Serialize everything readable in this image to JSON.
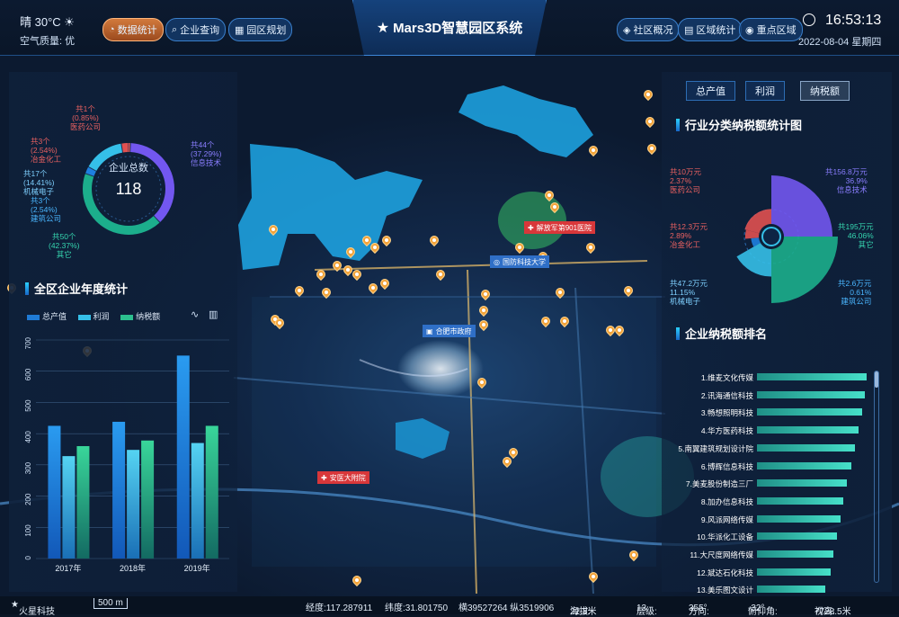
{
  "header": {
    "weather": "晴 30°C",
    "air_quality_label": "空气质量:",
    "air_quality_value": "优",
    "title": "Mars3D智慧园区系统",
    "time": "16:53:13",
    "date": "2022-08-04 星期四",
    "nav_left": [
      "数据统计",
      "企业查询",
      "园区规划"
    ],
    "nav_right": [
      "社区概况",
      "区域统计",
      "重点区域"
    ]
  },
  "left_panel": {
    "donut": {
      "center_label": "企业总数",
      "center_value": "118",
      "labels": [
        {
          "count": "共1个",
          "pct": "(0.85%)",
          "name": "医药公司"
        },
        {
          "count": "共3个",
          "pct": "(2.54%)",
          "name": "冶金化工"
        },
        {
          "count": "共17个",
          "pct": "(14.41%)",
          "name": "机械电子"
        },
        {
          "count": "共3个",
          "pct": "(2.54%)",
          "name": "建筑公司"
        },
        {
          "count": "共50个",
          "pct": "(42.37%)",
          "name": "其它"
        },
        {
          "count": "共44个",
          "pct": "(37.29%)",
          "name": "信息技术"
        }
      ]
    },
    "annual": {
      "title": "全区企业年度统计",
      "legend": [
        "总产值",
        "利润",
        "纳税额"
      ]
    }
  },
  "right_panel": {
    "tabs": [
      "总产值",
      "利润",
      "纳税额"
    ],
    "industry_title": "行业分类纳税额统计图",
    "industry_labels": [
      {
        "value": "共10万元",
        "pct": "2.37%",
        "name": "医药公司"
      },
      {
        "value": "共156.8万元",
        "pct": "36.9%",
        "name": "信息技术"
      },
      {
        "value": "共12.3万元",
        "pct": "2.89%",
        "name": "冶金化工"
      },
      {
        "value": "共195万元",
        "pct": "46.06%",
        "name": "其它"
      },
      {
        "value": "共47.2万元",
        "pct": "11.15%",
        "name": "机械电子"
      },
      {
        "value": "共2.6万元",
        "pct": "0.61%",
        "name": "建筑公司"
      }
    ],
    "ranking_title": "企业纳税额排名"
  },
  "map": {
    "pois": [
      "解放军第901医院",
      "国防科技大学",
      "合肥市政府",
      "安医大附院"
    ]
  },
  "status_bar": {
    "brand": "火星科技",
    "scale": "500 m",
    "lng": "经度:117.287911",
    "lat": "纬度:31.801750",
    "xy": "横39527264 纵3519906",
    "alt": "海拔:",
    "alt_value": "22.3米",
    "level": "层级:",
    "level_value": "13",
    "heading": "方向:",
    "heading_value": "355°",
    "pitch": "俯仰角:",
    "pitch_value": "-32°",
    "height": "视高:",
    "height_value": "7728.5米"
  },
  "colors": {
    "accent": "#2ad0ff",
    "orange": "#f2a33a",
    "active_tab": "#d27a3d"
  },
  "chart_data": [
    {
      "type": "bar",
      "title": "全区企业年度统计",
      "categories": [
        "2017年",
        "2018年",
        "2019年"
      ],
      "series": [
        {
          "name": "总产值",
          "values": [
            425,
            438,
            650
          ]
        },
        {
          "name": "利润",
          "values": [
            328,
            348,
            370
          ]
        },
        {
          "name": "纳税额",
          "values": [
            360,
            378,
            425
          ]
        }
      ],
      "ylim": [
        0,
        700
      ],
      "yticks": [
        0,
        100,
        200,
        300,
        400,
        500,
        600,
        700
      ]
    },
    {
      "type": "pie",
      "title": "行业分类纳税额统计图",
      "categories": [
        "医药公司",
        "信息技术",
        "冶金化工",
        "其它",
        "机械电子",
        "建筑公司"
      ],
      "values": [
        10,
        156.8,
        12.3,
        195,
        47.2,
        2.6
      ]
    },
    {
      "type": "bar",
      "title": "企业纳税额排名",
      "categories": [
        "1.维麦文化传媒",
        "2.讯海通信科技",
        "3.畅想照明科技",
        "4.华方医药科技",
        "5.南翼建筑规划设计院",
        "6.博辉信息科技",
        "7.美麦股份制造三厂",
        "8.加办信息科技",
        "9.风派网络传媒",
        "10.华派化工设备",
        "11.大尺度网络传媒",
        "12.斌达石化科技",
        "13.美乐图文设计"
      ],
      "values": [
        100,
        98,
        96,
        93,
        89,
        86,
        82,
        79,
        76,
        73,
        70,
        67,
        62
      ]
    }
  ]
}
